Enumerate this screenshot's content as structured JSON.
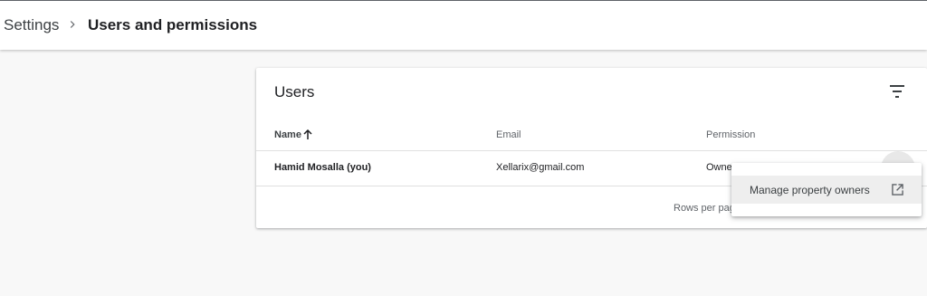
{
  "breadcrumb": {
    "root": "Settings",
    "current": "Users and permissions"
  },
  "users_card": {
    "title": "Users",
    "columns": {
      "name": "Name",
      "email": "Email",
      "permission": "Permission"
    },
    "rows": [
      {
        "name": "Hamid Mosalla (you)",
        "email": "Xellarix@gmail.com",
        "permission": "Owne"
      }
    ],
    "footer": {
      "rows_per_page": "Rows per pag"
    }
  },
  "menu": {
    "items": [
      {
        "label": "Manage property owners",
        "icon": "open-in-new-icon"
      }
    ]
  },
  "icons": {
    "separator": "chevron-right-icon",
    "filter": "filter-list-icon",
    "sort": "arrow-upward-icon"
  }
}
